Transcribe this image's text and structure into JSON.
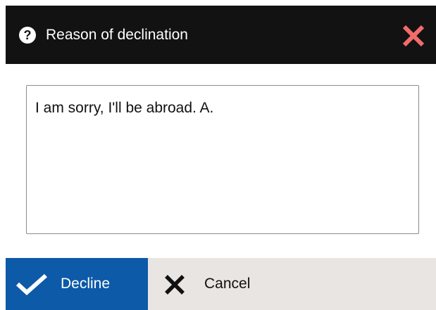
{
  "dialog": {
    "title": "Reason of declination",
    "help_icon": "question-circle-icon",
    "help_glyph": "?",
    "close_icon": "close-x-icon"
  },
  "reason": {
    "value": "I am sorry, I'll be abroad. A."
  },
  "footer": {
    "decline_label": "Decline",
    "decline_icon": "checkmark-icon",
    "cancel_label": "Cancel",
    "cancel_icon": "x-icon"
  },
  "colors": {
    "titlebar_bg": "#121212",
    "close_icon": "#f26b6b",
    "decline_bg": "#0c5aa8",
    "footer_bg": "#e9e5e2"
  }
}
